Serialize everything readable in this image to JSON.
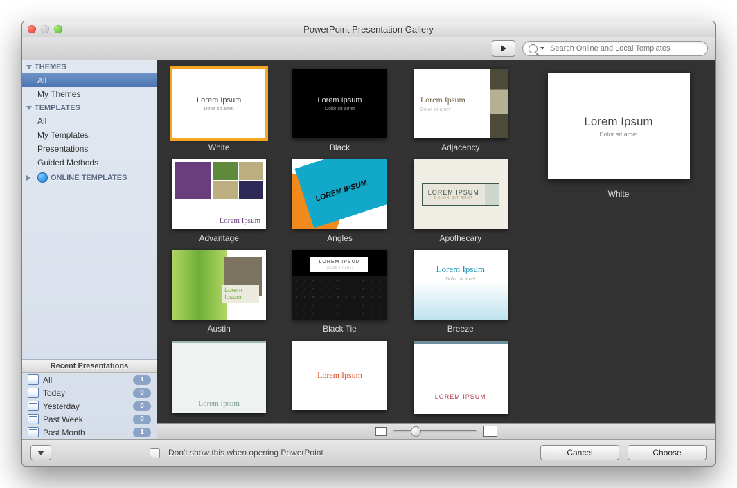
{
  "window": {
    "title": "PowerPoint Presentation Gallery"
  },
  "search": {
    "placeholder": "Search Online and Local Templates"
  },
  "sidebar": {
    "themes_header": "THEMES",
    "themes": [
      {
        "label": "All",
        "selected": true
      },
      {
        "label": "My Themes",
        "selected": false
      }
    ],
    "templates_header": "TEMPLATES",
    "templates": [
      {
        "label": "All"
      },
      {
        "label": "My Templates"
      },
      {
        "label": "Presentations"
      },
      {
        "label": "Guided Methods"
      }
    ],
    "online_header": "ONLINE TEMPLATES"
  },
  "recent": {
    "header": "Recent Presentations",
    "items": [
      {
        "label": "All",
        "count": "1"
      },
      {
        "label": "Today",
        "count": "0"
      },
      {
        "label": "Yesterday",
        "count": "0"
      },
      {
        "label": "Past Week",
        "count": "0"
      },
      {
        "label": "Past Month",
        "count": "1"
      }
    ]
  },
  "thumbs": [
    {
      "name": "White",
      "title": "Lorem Ipsum",
      "sub": "Dolor sit amet",
      "selected": true
    },
    {
      "name": "Black",
      "title": "Lorem Ipsum",
      "sub": "Dolor sit amet"
    },
    {
      "name": "Adjacency",
      "title": "Lorem Ipsum",
      "sub": "Dolor sit amet"
    },
    {
      "name": "Advantage",
      "title": "Lorem Ipsum",
      "sub": ""
    },
    {
      "name": "Angles",
      "title": "LOREM IPSUM",
      "sub": ""
    },
    {
      "name": "Apothecary",
      "title": "LOREM IPSUM",
      "sub": "DOLOR SIT AMET"
    },
    {
      "name": "Austin",
      "title": "Lorem Ipsum",
      "sub": ""
    },
    {
      "name": "Black Tie",
      "title": "LOREM IPSUM",
      "sub": "DOLOR SIT AMET"
    },
    {
      "name": "Breeze",
      "title": "Lorem Ipsum",
      "sub": "Dolor sit amet"
    },
    {
      "name": "",
      "title": "Lorem Ipsum",
      "sub": ""
    },
    {
      "name": "",
      "title": "Lorem Ipsum",
      "sub": ""
    },
    {
      "name": "",
      "title": "LOREM IPSUM",
      "sub": ""
    }
  ],
  "preview": {
    "name": "White",
    "title": "Lorem Ipsum",
    "sub": "Dolor sit amet"
  },
  "footer": {
    "dontshow": "Don't show this when opening PowerPoint",
    "cancel": "Cancel",
    "choose": "Choose"
  }
}
